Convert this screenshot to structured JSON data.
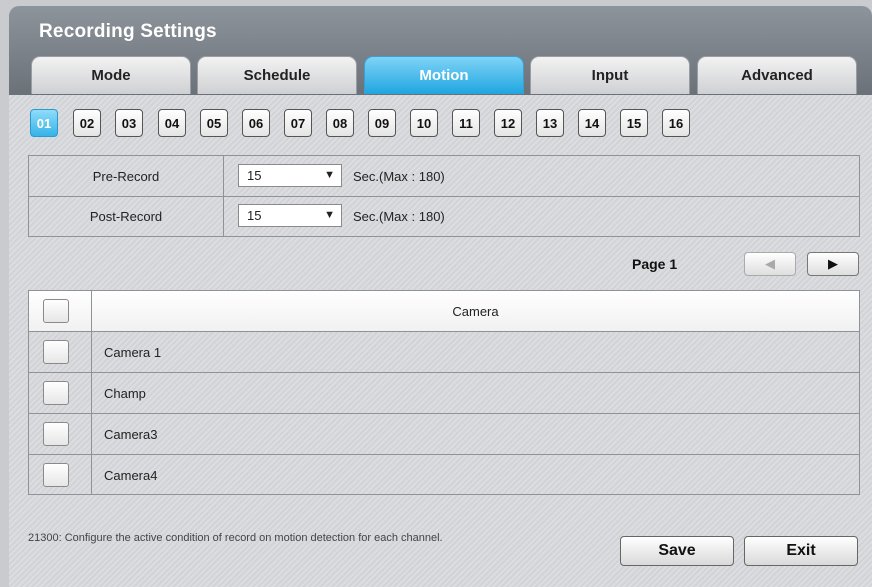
{
  "window": {
    "title": "Recording Settings"
  },
  "tabs": [
    {
      "label": "Mode"
    },
    {
      "label": "Schedule"
    },
    {
      "label": "Motion",
      "active": true
    },
    {
      "label": "Input"
    },
    {
      "label": "Advanced"
    }
  ],
  "channels": [
    "01",
    "02",
    "03",
    "04",
    "05",
    "06",
    "07",
    "08",
    "09",
    "10",
    "11",
    "12",
    "13",
    "14",
    "15",
    "16"
  ],
  "active_channel": "01",
  "recording": {
    "pre": {
      "label": "Pre-Record",
      "value": "15",
      "note": "Sec.(Max : 180)"
    },
    "post": {
      "label": "Post-Record",
      "value": "15",
      "note": "Sec.(Max : 180)"
    }
  },
  "pagination": {
    "label": "Page 1",
    "prev_icon": "left-triangle-icon",
    "next_icon": "right-triangle-icon"
  },
  "camera_table": {
    "header": "Camera",
    "rows": [
      {
        "name": "Camera 1",
        "checked": false
      },
      {
        "name": "Champ",
        "checked": false
      },
      {
        "name": "Camera3",
        "checked": false
      },
      {
        "name": "Camera4",
        "checked": false
      }
    ]
  },
  "help_text": "21300: Configure the active condition of record on motion detection for each channel.",
  "buttons": {
    "save": "Save",
    "exit": "Exit"
  },
  "colors": {
    "accent": "#1fa6e0",
    "titlebar": "#7b8188"
  }
}
